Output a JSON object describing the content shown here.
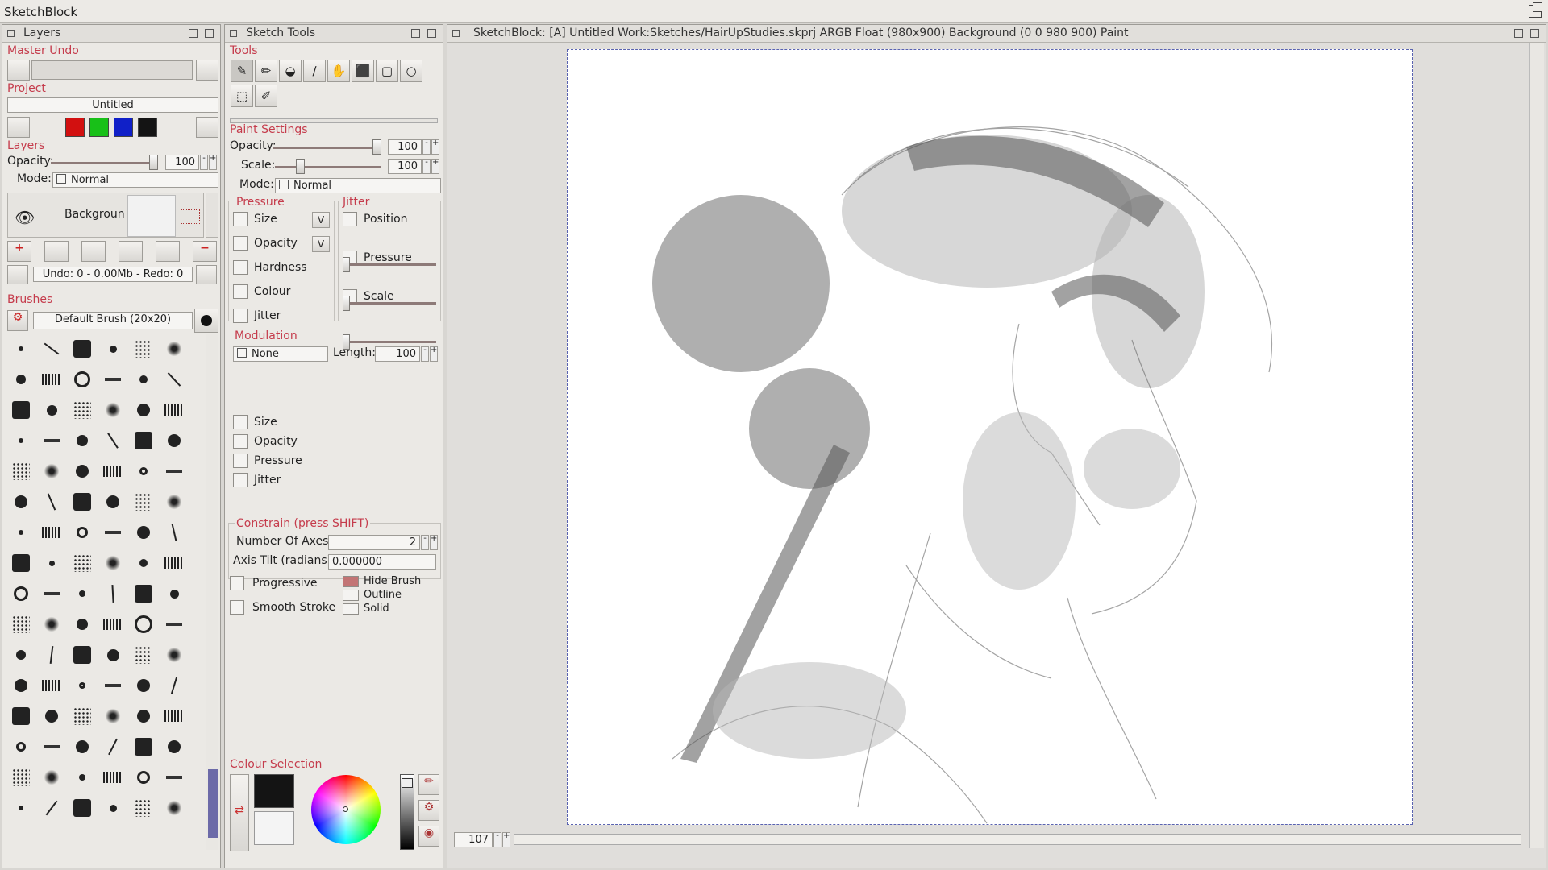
{
  "app": {
    "title": "SketchBlock"
  },
  "layers_panel": {
    "title": "Layers",
    "master_undo": "Master Undo",
    "project_label": "Project",
    "project_name": "Untitled",
    "swatches": [
      "#d21010",
      "#18c018",
      "#1020c8",
      "#141414"
    ],
    "layers_label": "Layers",
    "opacity_label": "Opacity:",
    "opacity_value": "100",
    "mode_label": "Mode:",
    "mode_value": "Normal",
    "layer_name": "Backgroun",
    "undo_status": "Undo: 0 - 0.00Mb - Redo: 0",
    "brushes_label": "Brushes",
    "brush_name": "Default Brush (20x20)"
  },
  "tools_panel": {
    "title": "Sketch Tools",
    "tools_label": "Tools",
    "tool_icons": [
      "brush-icon",
      "pencil-icon",
      "smudge-icon",
      "knife-icon",
      "hand-icon",
      "fill-icon",
      "rect-select-icon",
      "circle-select-icon",
      "transform-icon",
      "eyedropper-icon"
    ],
    "paint_settings_label": "Paint Settings",
    "opacity_label": "Opacity:",
    "opacity_value": "100",
    "scale_label": "Scale:",
    "scale_value": "100",
    "mode_label": "Mode:",
    "mode_value": "Normal",
    "pressure_label": "Pressure",
    "pressure_items": [
      "Size",
      "Opacity",
      "Hardness",
      "Colour",
      "Jitter"
    ],
    "jitter_label": "Jitter",
    "jitter_items": [
      "Position",
      "Pressure",
      "Scale"
    ],
    "modulation_label": "Modulation",
    "modulation_value": "None",
    "length_label": "Length:",
    "length_value": "100",
    "mod_items": [
      "Size",
      "Opacity",
      "Pressure",
      "Jitter"
    ],
    "constrain_label": "Constrain (press SHIFT)",
    "axes_label": "Number Of Axes:",
    "axes_value": "2",
    "tilt_label": "Axis Tilt (radians):",
    "tilt_value": "0.000000",
    "progressive_label": "Progressive",
    "smooth_label": "Smooth Stroke",
    "hide_brush_label": "Hide Brush",
    "outline_label": "Outline",
    "solid_label": "Solid",
    "colour_selection_label": "Colour Selection",
    "fg_colour": "#141414",
    "bg_colour": "#f4f4f4"
  },
  "canvas_panel": {
    "title": "SketchBlock:  [A]  Untitled  Work:Sketches/HairUpStudies.skprj ARGB Float (980x900) Background (0 0 980 900) Paint",
    "zoom_value": "107"
  }
}
